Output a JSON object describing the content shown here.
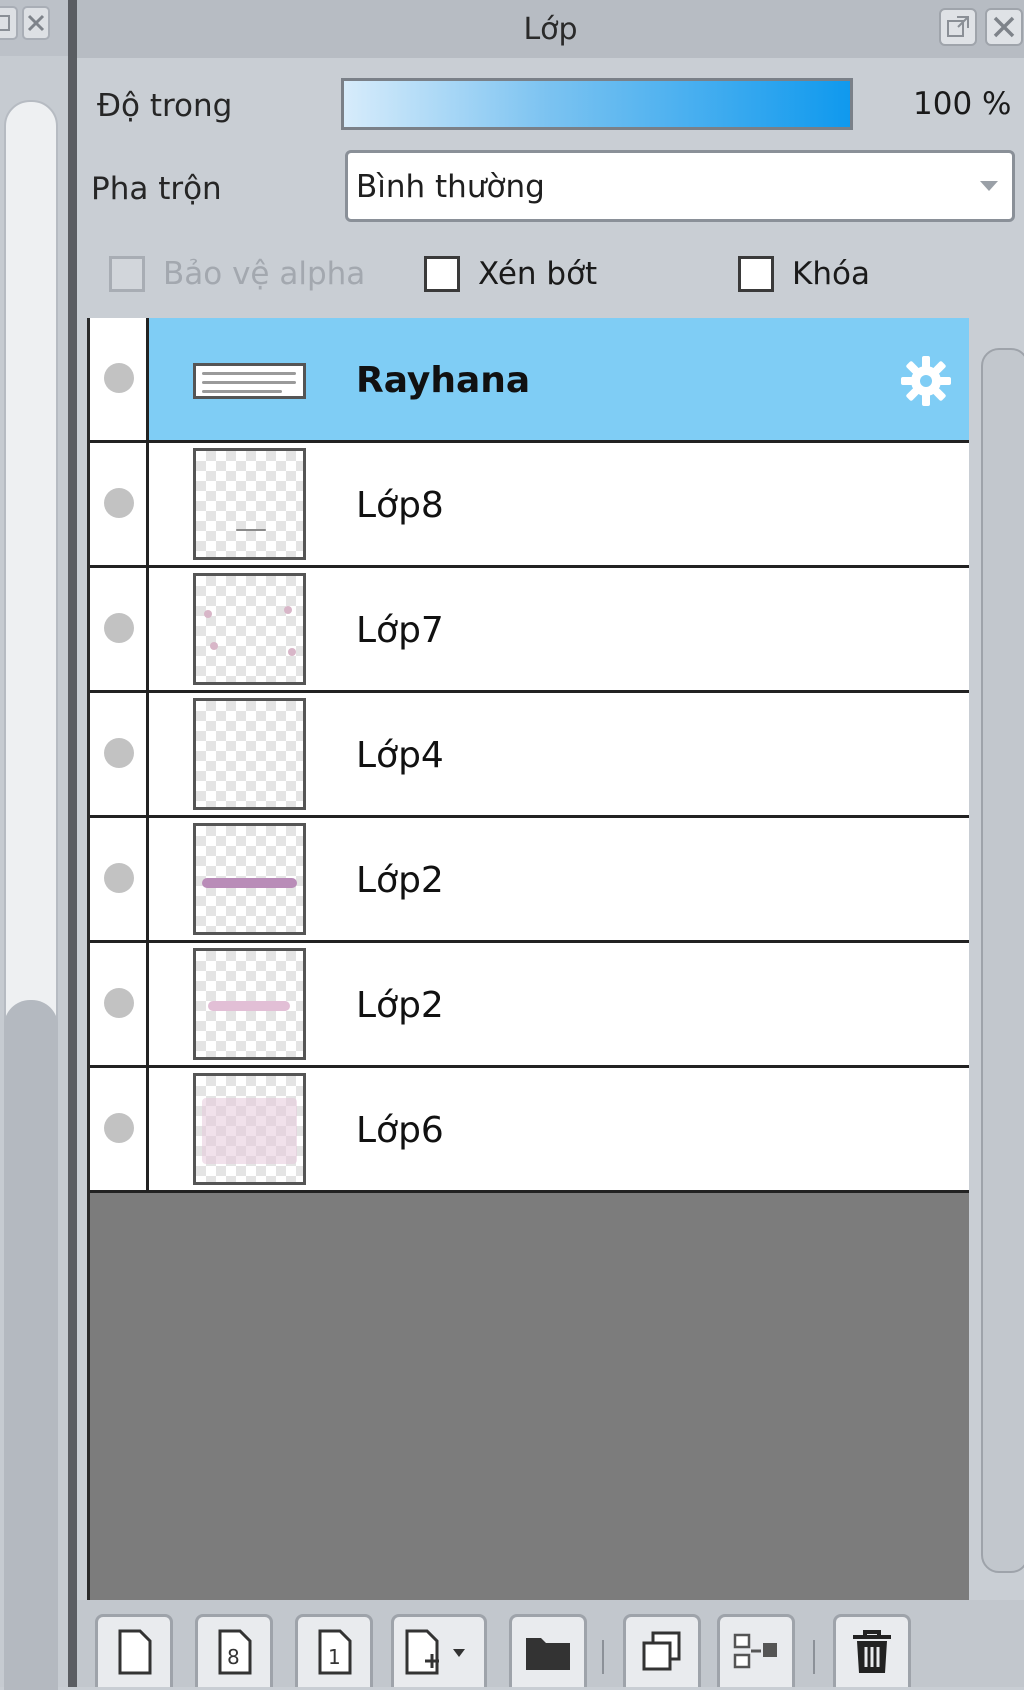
{
  "panel": {
    "title": "Lớp",
    "opacity_label": "Độ trong",
    "opacity_value": "100 %",
    "opacity_fraction": 1.0,
    "blend_label": "Pha trộn",
    "blend_value": "Bình thường",
    "checkboxes": [
      {
        "label": "Bảo vệ alpha",
        "checked": false,
        "enabled": false
      },
      {
        "label": "Xén bớt",
        "checked": false,
        "enabled": true
      },
      {
        "label": "Khóa",
        "checked": false,
        "enabled": true
      }
    ]
  },
  "layers": [
    {
      "name": "Rayhana",
      "selected": true,
      "type": "text"
    },
    {
      "name": "Lớp8",
      "selected": false,
      "type": "raster"
    },
    {
      "name": "Lớp7",
      "selected": false,
      "type": "raster"
    },
    {
      "name": "Lớp4",
      "selected": false,
      "type": "raster"
    },
    {
      "name": "Lớp2",
      "selected": false,
      "type": "raster"
    },
    {
      "name": "Lớp2",
      "selected": false,
      "type": "raster"
    },
    {
      "name": "Lớp6",
      "selected": false,
      "type": "raster"
    }
  ],
  "toolbar": {
    "buttons": [
      "new-layer",
      "new-layer-8bit",
      "new-layer-1bit",
      "new-layer-menu",
      "new-folder",
      "duplicate-layer",
      "merge-layer",
      "delete-layer"
    ]
  },
  "colors": {
    "selected_row": "#7fcdf5",
    "opacity_bar_end": "#0f99ee",
    "list_background": "#7c7c7c"
  }
}
